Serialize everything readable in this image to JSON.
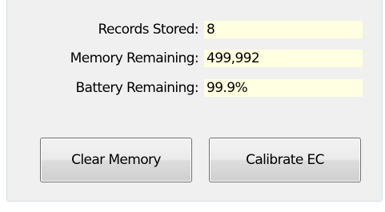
{
  "status": {
    "rows": [
      {
        "label": "Records Stored:",
        "value": "8"
      },
      {
        "label": "Memory Remaining:",
        "value": "499,992"
      },
      {
        "label": "Battery Remaining:",
        "value": "99.9%"
      }
    ]
  },
  "buttons": {
    "clear_memory": "Clear Memory",
    "calibrate_ec": "Calibrate EC"
  },
  "colors": {
    "value_background": "#ffffe1",
    "panel_background": "#f0f0f0",
    "group_border": "#d5dfe5"
  }
}
